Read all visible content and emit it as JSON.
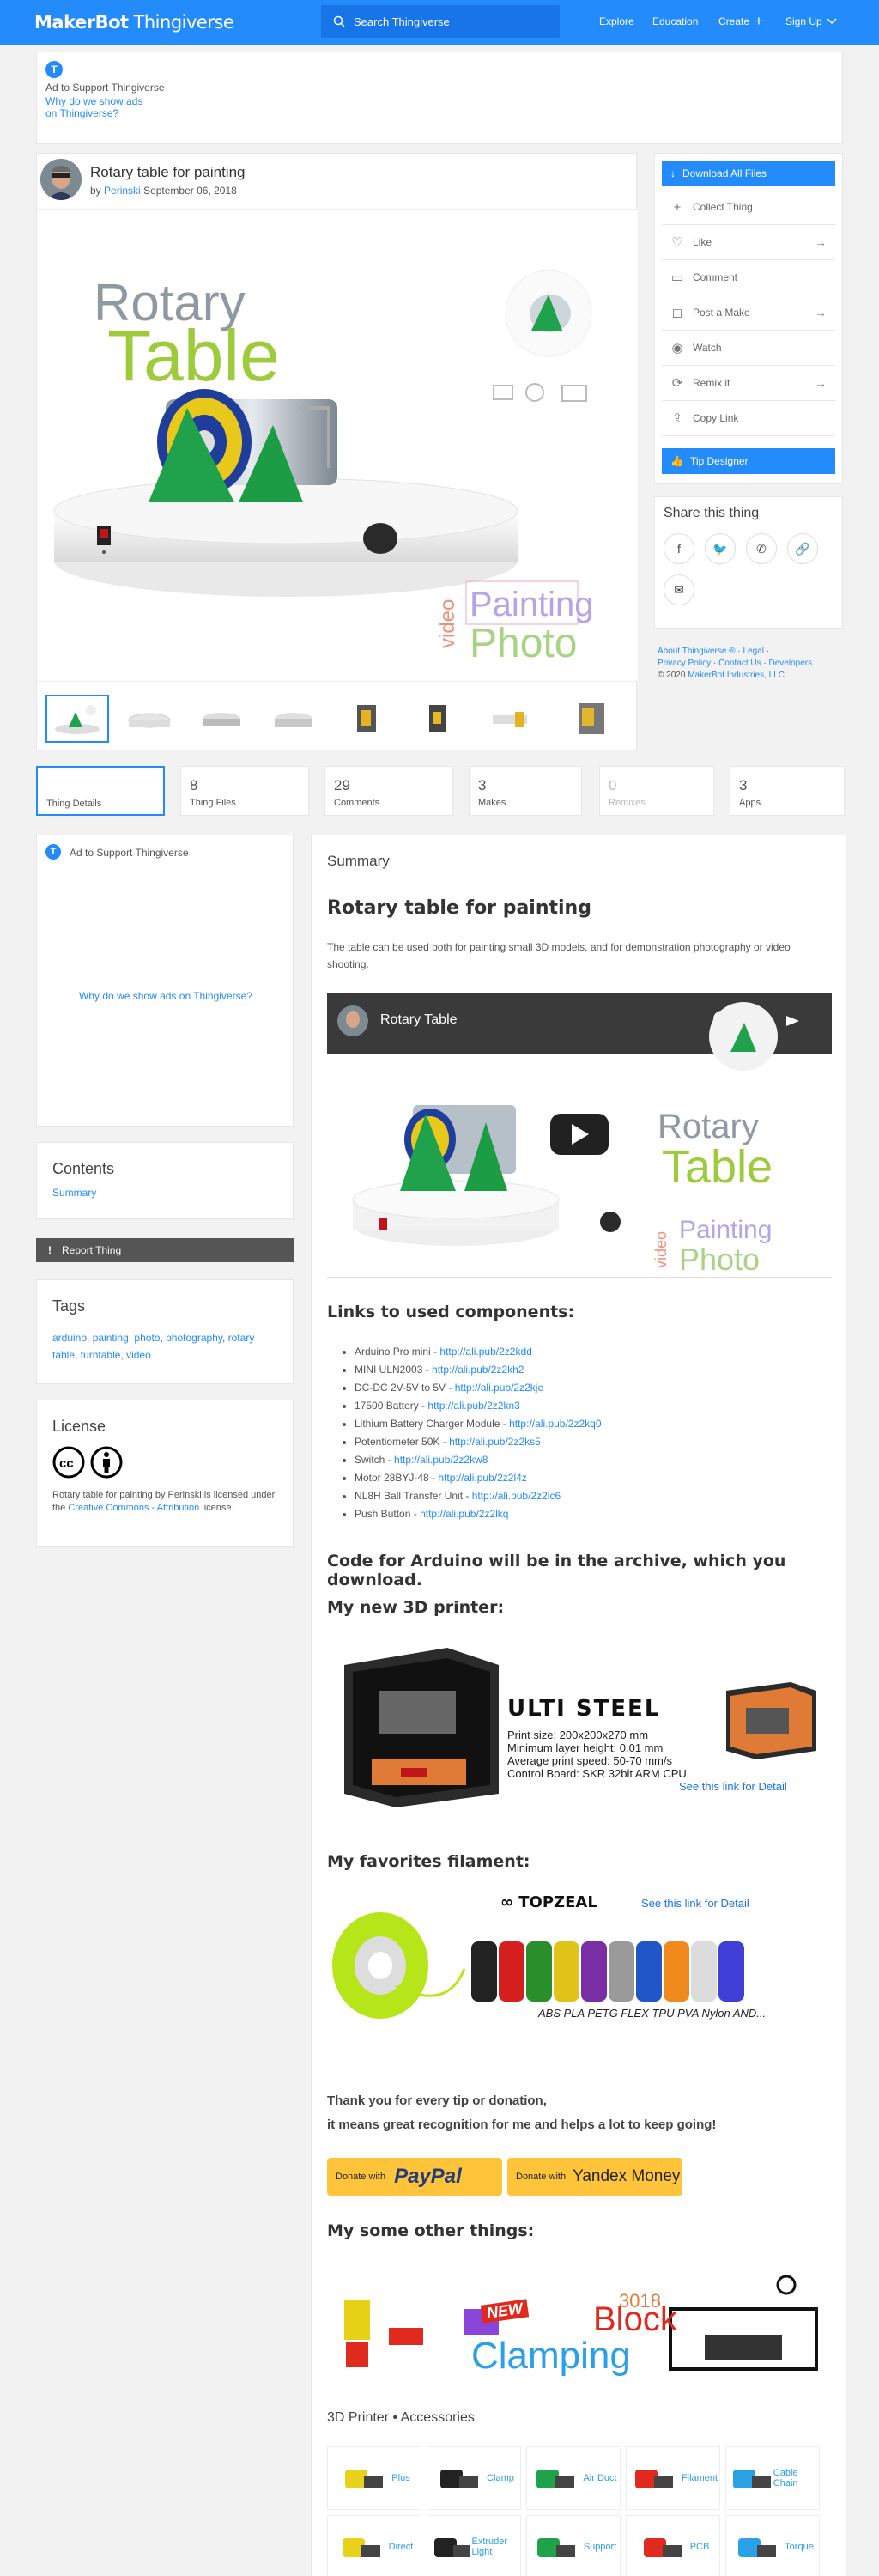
{
  "header": {
    "logo_brand": "MakerBot",
    "logo_product": "Thingiverse",
    "search_placeholder": "Search Thingiverse",
    "nav": [
      "Explore",
      "Education",
      "Create",
      "Sign Up"
    ]
  },
  "top_ad": {
    "badge": "T",
    "label": "Ad to Support Thingiverse",
    "why_line1": "Why do we show ads",
    "why_line2": "on Thingiverse?"
  },
  "thing": {
    "title": "Rotary table for painting",
    "by_prefix": "by",
    "author": "Perinski",
    "date": "September 06, 2018",
    "hero_text": {
      "rotary": "Rotary",
      "table": "Table",
      "video": "video",
      "painting": "Painting",
      "photo": "Photo"
    }
  },
  "actions": {
    "download": "Download All Files",
    "items": [
      {
        "label": "Collect Thing",
        "icon": "plus-icon",
        "arrow": false
      },
      {
        "label": "Like",
        "icon": "heart-icon",
        "arrow": true
      },
      {
        "label": "Comment",
        "icon": "comment-icon",
        "arrow": false
      },
      {
        "label": "Post a Make",
        "icon": "camera-icon",
        "arrow": true
      },
      {
        "label": "Watch",
        "icon": "eye-icon",
        "arrow": false
      },
      {
        "label": "Remix it",
        "icon": "remix-icon",
        "arrow": true
      },
      {
        "label": "Copy Link",
        "icon": "share-icon",
        "arrow": false
      }
    ],
    "tip": "Tip Designer"
  },
  "share": {
    "title": "Share this thing",
    "icons": [
      "facebook-icon",
      "twitter-icon",
      "whatsapp-icon",
      "link-icon",
      "email-icon"
    ]
  },
  "footer_links": {
    "line1": [
      "About Thingiverse ®",
      "Legal"
    ],
    "line2": [
      "Privacy Policy",
      "Contact Us",
      "Developers"
    ],
    "copyright_prefix": "© 2020",
    "copyright_link": "MakerBot Industries, LLC"
  },
  "tabs": [
    {
      "count": "",
      "label": "Thing Details"
    },
    {
      "count": "8",
      "label": "Thing Files"
    },
    {
      "count": "29",
      "label": "Comments"
    },
    {
      "count": "3",
      "label": "Makes"
    },
    {
      "count": "0",
      "label": "Remixes"
    },
    {
      "count": "3",
      "label": "Apps"
    }
  ],
  "side_ad": {
    "badge": "T",
    "label": "Ad to Support Thingiverse",
    "why": "Why do we show ads on Thingiverse?"
  },
  "contents": {
    "title": "Contents",
    "item": "Summary"
  },
  "report": "Report Thing",
  "tags": {
    "title": "Tags",
    "items": [
      "arduino",
      "painting",
      "photo",
      "photography",
      "rotary table",
      "turntable",
      "video"
    ]
  },
  "license": {
    "title": "License",
    "text1": "Rotary table for painting by Perinski is licensed under the",
    "link": "Creative Commons - Attribution",
    "text2": "license."
  },
  "summary": {
    "heading": "Summary",
    "title": "Rotary table for painting",
    "description": "The table can be used both for painting small 3D models, and for demonstration photography or video shooting.",
    "video_title": "Rotary Table",
    "links_heading": "Links to used components:",
    "components": [
      {
        "name": "Arduino Pro mini",
        "url": "http://ali.pub/2z2kdd"
      },
      {
        "name": "MINI ULN2003",
        "url": "http://ali.pub/2z2kh2"
      },
      {
        "name": "DC-DC 2V-5V to 5V",
        "url": "http://ali.pub/2z2kje"
      },
      {
        "name": "17500 Battery",
        "url": "http://ali.pub/2z2kn3"
      },
      {
        "name": "Lithium Battery Charger Module",
        "url": "http://ali.pub/2z2kq0"
      },
      {
        "name": "Potentiometer 50K",
        "url": "http://ali.pub/2z2ks5"
      },
      {
        "name": "Switch",
        "url": "http://ali.pub/2z2kw8"
      },
      {
        "name": "Motor 28BYJ-48",
        "url": "http://ali.pub/2z2l4z"
      },
      {
        "name": "NL8H Ball Transfer Unit",
        "url": "http://ali.pub/2z2lc6"
      },
      {
        "name": "Push Button",
        "url": "http://ali.pub/2z2lkq"
      }
    ],
    "code_heading": "Code for Arduino will be in the archive, which you download.",
    "printer_heading": "My new 3D printer:",
    "printer": {
      "name": "ULTI STEEL",
      "specs": [
        "Print size: 200x200x270 mm",
        "Minimum layer height: 0.01 mm",
        "Average print speed: 50-70 mm/s",
        "Control Board: SKR 32bit ARM CPU"
      ],
      "link": "See this link for Detail"
    },
    "filament_heading": "My favorites filament:",
    "filament": {
      "brand": "TOPZEAL",
      "link": "See this link for Detail",
      "types": "ABS PLA PETG FLEX TPU PVA Nylon AND..."
    },
    "thanks_line1": "Thank you for every tip or donation,",
    "thanks_line2": "it means great recognition for me and helps a lot to keep going!",
    "donate": [
      {
        "prefix": "Donate with",
        "brand": "PayPal"
      },
      {
        "prefix": "Donate with",
        "brand": "Yandex Money"
      }
    ],
    "other_heading": "My some other things:",
    "other_banner": {
      "new": "NEW",
      "block": "Block",
      "clamping": "Clamping",
      "year": "3018"
    },
    "accessories_heading": "3D Printer • Accessories",
    "accessory_labels": [
      "Plus",
      "Clamp",
      "Air Duct",
      "Filament",
      "Cable Chain",
      "Direct",
      "Extruder Light",
      "Support",
      "PCB",
      "Torque"
    ]
  },
  "colors": {
    "brand": "#248bfb",
    "background": "#f2f2f2"
  }
}
